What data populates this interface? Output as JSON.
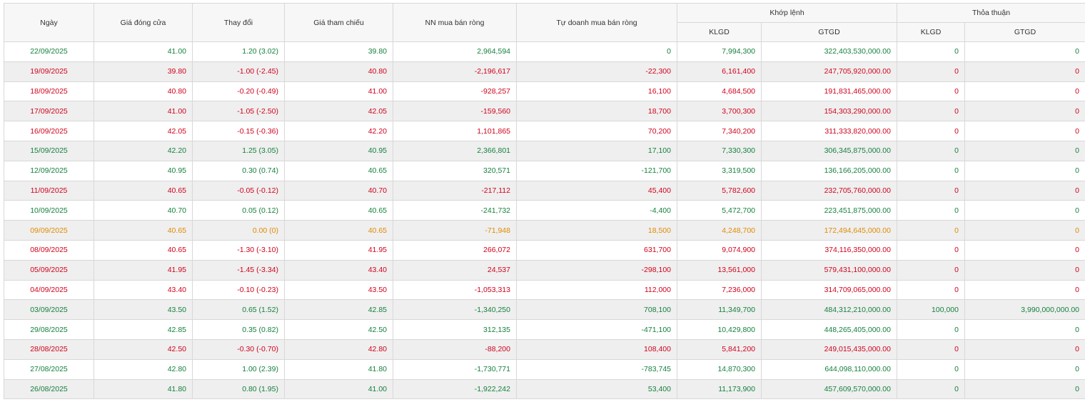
{
  "colors": {
    "up": "#15803d",
    "down": "#d0021b",
    "flat": "#e08a00"
  },
  "headers": {
    "date": "Ngày",
    "close": "Giá đóng cửa",
    "change": "Thay đổi",
    "reference": "Giá tham chiếu",
    "foreign_net": "NN mua bán ròng",
    "prop_net": "Tự doanh mua bán ròng",
    "matched": "Khớp lệnh",
    "negotiated": "Thỏa thuận",
    "klgd": "KLGD",
    "gtgd": "GTGD"
  },
  "rows": [
    {
      "trend": "up",
      "date": "22/09/2025",
      "close": "41.00",
      "change": "1.20 (3.02)",
      "ref": "39.80",
      "nn": "2,964,594",
      "td": "0",
      "m_klgd": "7,994,300",
      "m_gtgd": "322,403,530,000.00",
      "t_klgd": "0",
      "t_gtgd": "0"
    },
    {
      "trend": "down",
      "date": "19/09/2025",
      "close": "39.80",
      "change": "-1.00 (-2.45)",
      "ref": "40.80",
      "nn": "-2,196,617",
      "td": "-22,300",
      "m_klgd": "6,161,400",
      "m_gtgd": "247,705,920,000.00",
      "t_klgd": "0",
      "t_gtgd": "0"
    },
    {
      "trend": "down",
      "date": "18/09/2025",
      "close": "40.80",
      "change": "-0.20 (-0.49)",
      "ref": "41.00",
      "nn": "-928,257",
      "td": "16,100",
      "m_klgd": "4,684,500",
      "m_gtgd": "191,831,465,000.00",
      "t_klgd": "0",
      "t_gtgd": "0"
    },
    {
      "trend": "down",
      "date": "17/09/2025",
      "close": "41.00",
      "change": "-1.05 (-2.50)",
      "ref": "42.05",
      "nn": "-159,560",
      "td": "18,700",
      "m_klgd": "3,700,300",
      "m_gtgd": "154,303,290,000.00",
      "t_klgd": "0",
      "t_gtgd": "0"
    },
    {
      "trend": "down",
      "date": "16/09/2025",
      "close": "42.05",
      "change": "-0.15 (-0.36)",
      "ref": "42.20",
      "nn": "1,101,865",
      "td": "70,200",
      "m_klgd": "7,340,200",
      "m_gtgd": "311,333,820,000.00",
      "t_klgd": "0",
      "t_gtgd": "0"
    },
    {
      "trend": "up",
      "date": "15/09/2025",
      "close": "42.20",
      "change": "1.25 (3.05)",
      "ref": "40.95",
      "nn": "2,366,801",
      "td": "17,100",
      "m_klgd": "7,330,300",
      "m_gtgd": "306,345,875,000.00",
      "t_klgd": "0",
      "t_gtgd": "0"
    },
    {
      "trend": "up",
      "date": "12/09/2025",
      "close": "40.95",
      "change": "0.30 (0.74)",
      "ref": "40.65",
      "nn": "320,571",
      "td": "-121,700",
      "m_klgd": "3,319,500",
      "m_gtgd": "136,166,205,000.00",
      "t_klgd": "0",
      "t_gtgd": "0"
    },
    {
      "trend": "down",
      "date": "11/09/2025",
      "close": "40.65",
      "change": "-0.05 (-0.12)",
      "ref": "40.70",
      "nn": "-217,112",
      "td": "45,400",
      "m_klgd": "5,782,600",
      "m_gtgd": "232,705,760,000.00",
      "t_klgd": "0",
      "t_gtgd": "0"
    },
    {
      "trend": "up",
      "date": "10/09/2025",
      "close": "40.70",
      "change": "0.05 (0.12)",
      "ref": "40.65",
      "nn": "-241,732",
      "td": "-4,400",
      "m_klgd": "5,472,700",
      "m_gtgd": "223,451,875,000.00",
      "t_klgd": "0",
      "t_gtgd": "0"
    },
    {
      "trend": "flat",
      "date": "09/09/2025",
      "close": "40.65",
      "change": "0.00 (0)",
      "ref": "40.65",
      "nn": "-71,948",
      "td": "18,500",
      "m_klgd": "4,248,700",
      "m_gtgd": "172,494,645,000.00",
      "t_klgd": "0",
      "t_gtgd": "0"
    },
    {
      "trend": "down",
      "date": "08/09/2025",
      "close": "40.65",
      "change": "-1.30 (-3.10)",
      "ref": "41.95",
      "nn": "266,072",
      "td": "631,700",
      "m_klgd": "9,074,900",
      "m_gtgd": "374,116,350,000.00",
      "t_klgd": "0",
      "t_gtgd": "0"
    },
    {
      "trend": "down",
      "date": "05/09/2025",
      "close": "41.95",
      "change": "-1.45 (-3.34)",
      "ref": "43.40",
      "nn": "24,537",
      "td": "-298,100",
      "m_klgd": "13,561,000",
      "m_gtgd": "579,431,100,000.00",
      "t_klgd": "0",
      "t_gtgd": "0"
    },
    {
      "trend": "down",
      "date": "04/09/2025",
      "close": "43.40",
      "change": "-0.10 (-0.23)",
      "ref": "43.50",
      "nn": "-1,053,313",
      "td": "112,000",
      "m_klgd": "7,236,000",
      "m_gtgd": "314,709,065,000.00",
      "t_klgd": "0",
      "t_gtgd": "0"
    },
    {
      "trend": "up",
      "date": "03/09/2025",
      "close": "43.50",
      "change": "0.65 (1.52)",
      "ref": "42.85",
      "nn": "-1,340,250",
      "td": "708,100",
      "m_klgd": "11,349,700",
      "m_gtgd": "484,312,210,000.00",
      "t_klgd": "100,000",
      "t_gtgd": "3,990,000,000.00"
    },
    {
      "trend": "up",
      "date": "29/08/2025",
      "close": "42.85",
      "change": "0.35 (0.82)",
      "ref": "42.50",
      "nn": "312,135",
      "td": "-471,100",
      "m_klgd": "10,429,800",
      "m_gtgd": "448,265,405,000.00",
      "t_klgd": "0",
      "t_gtgd": "0"
    },
    {
      "trend": "down",
      "date": "28/08/2025",
      "close": "42.50",
      "change": "-0.30 (-0.70)",
      "ref": "42.80",
      "nn": "-88,200",
      "td": "108,400",
      "m_klgd": "5,841,200",
      "m_gtgd": "249,015,435,000.00",
      "t_klgd": "0",
      "t_gtgd": "0"
    },
    {
      "trend": "up",
      "date": "27/08/2025",
      "close": "42.80",
      "change": "1.00 (2.39)",
      "ref": "41.80",
      "nn": "-1,730,771",
      "td": "-783,745",
      "m_klgd": "14,870,300",
      "m_gtgd": "644,098,110,000.00",
      "t_klgd": "0",
      "t_gtgd": "0"
    },
    {
      "trend": "up",
      "date": "26/08/2025",
      "close": "41.80",
      "change": "0.80 (1.95)",
      "ref": "41.00",
      "nn": "-1,922,242",
      "td": "53,400",
      "m_klgd": "11,173,900",
      "m_gtgd": "457,609,570,000.00",
      "t_klgd": "0",
      "t_gtgd": "0"
    }
  ]
}
